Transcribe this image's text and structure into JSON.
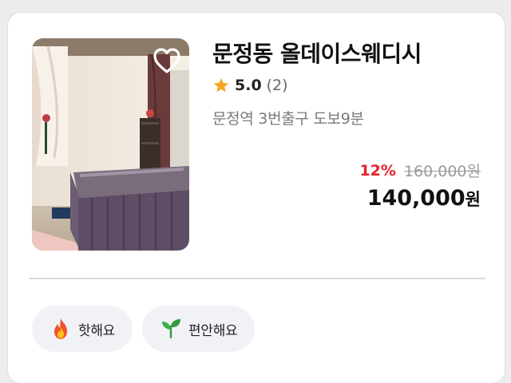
{
  "listing": {
    "title": "문정동 올데이스웨디시",
    "rating": "5.0",
    "review_count": "(2)",
    "location": "문정역 3번출구 도보9분",
    "discount": "12%",
    "original_price": "160,000원",
    "final_price": "140,000",
    "currency": "원",
    "favorited": false,
    "image_icon": "room-photo",
    "heart_icon": "heart-outline-icon"
  },
  "tags": [
    {
      "label": "핫해요",
      "icon": "fire-icon"
    },
    {
      "label": "편안해요",
      "icon": "leaf-icon"
    }
  ],
  "colors": {
    "discount": "#e8222d",
    "star": "#f5a623",
    "tag_bg": "#f1f2f6"
  }
}
